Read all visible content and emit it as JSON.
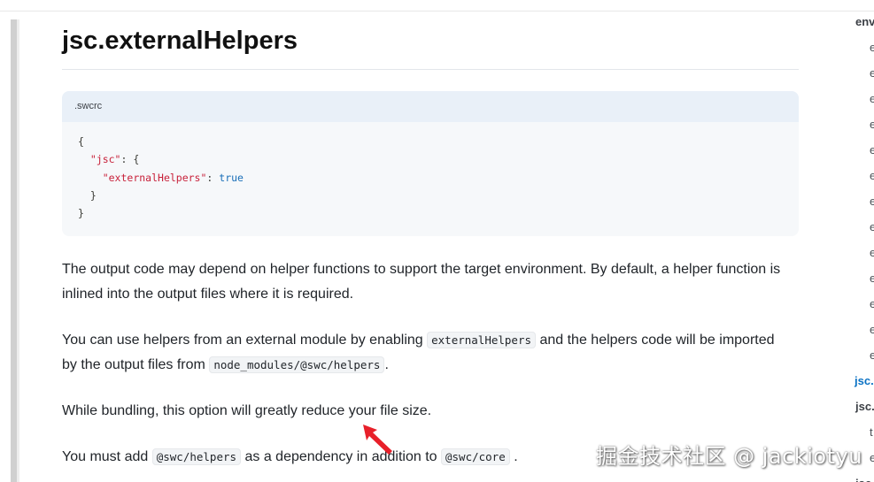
{
  "article": {
    "title": "jsc.externalHelpers",
    "code_filename": ".swcrc",
    "code_lines": [
      {
        "indent": "",
        "key": "",
        "sep": "{",
        "value": ""
      },
      {
        "indent": "  ",
        "key": "\"jsc\"",
        "sep": ": {",
        "value": ""
      },
      {
        "indent": "    ",
        "key": "\"externalHelpers\"",
        "sep": ": ",
        "value": "true"
      },
      {
        "indent": "  ",
        "key": "",
        "sep": "}",
        "value": ""
      },
      {
        "indent": "",
        "key": "",
        "sep": "}",
        "value": ""
      }
    ],
    "p1": "The output code may depend on helper functions to support the target environment. By default, a helper function is inlined into the output files where it is required.",
    "p2_a": "You can use helpers from an external module by enabling",
    "p2_code1": "externalHelpers",
    "p2_b": "and the helpers code will be imported by the output files from",
    "p2_code2": "node_modules/@swc/helpers",
    "p2_c": ".",
    "p3": "While bundling, this option will greatly reduce your file size.",
    "p4_a": "You must add",
    "p4_code1": "@swc/helpers",
    "p4_b": "as a dependency in addition to",
    "p4_code2": "@swc/core",
    "p4_c": "."
  },
  "toc": {
    "items": [
      {
        "label": "env",
        "kind": "head"
      },
      {
        "label": "e",
        "kind": "sub"
      },
      {
        "label": "e",
        "kind": "sub"
      },
      {
        "label": "e",
        "kind": "sub"
      },
      {
        "label": "e",
        "kind": "sub"
      },
      {
        "label": "e",
        "kind": "sub"
      },
      {
        "label": "e",
        "kind": "sub"
      },
      {
        "label": "e",
        "kind": "sub"
      },
      {
        "label": "e",
        "kind": "sub"
      },
      {
        "label": "e",
        "kind": "sub"
      },
      {
        "label": "e",
        "kind": "sub"
      },
      {
        "label": "e",
        "kind": "sub"
      },
      {
        "label": "e",
        "kind": "sub"
      },
      {
        "label": "e",
        "kind": "sub"
      },
      {
        "label": "jsc.",
        "kind": "active"
      },
      {
        "label": "jsc.",
        "kind": "head"
      },
      {
        "label": "t",
        "kind": "sub"
      },
      {
        "label": "e",
        "kind": "sub"
      },
      {
        "label": "jsc",
        "kind": "head"
      }
    ]
  },
  "overlay": {
    "watermark": "掘金技术社区 @ jackiotyu",
    "arrow_color": "#e8202a"
  }
}
